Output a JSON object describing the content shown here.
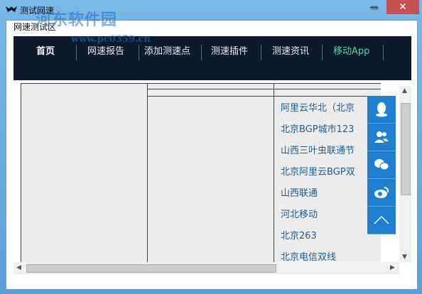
{
  "window": {
    "title": "测试网速",
    "minimize": "—",
    "maximize": "▭",
    "close": "✕"
  },
  "watermark": {
    "name": "河东软件园",
    "url": "www.pc0359.cn"
  },
  "group_label": "网速测试区",
  "nav": [
    {
      "label": "首页"
    },
    {
      "label": "网速报告"
    },
    {
      "label": "添加测速点"
    },
    {
      "label": "测速插件"
    },
    {
      "label": "测速资讯"
    },
    {
      "label": "移动App"
    }
  ],
  "servers": [
    "阿里云华北（北京",
    "北京BGP城市123",
    "山西三叶虫联通节",
    "北京阿里云BGP双",
    "山西联通",
    "河北移动",
    "北京263",
    "北京电信双线"
  ],
  "side_icons": [
    "qq-icon",
    "contacts-icon",
    "wechat-icon",
    "weibo-icon",
    "back-to-top-icon"
  ],
  "colors": {
    "nav_bg": "#0d1a2b",
    "accent": "#1e7fd0",
    "link": "#1d5f8f",
    "app_green": "#4fd9a0"
  }
}
